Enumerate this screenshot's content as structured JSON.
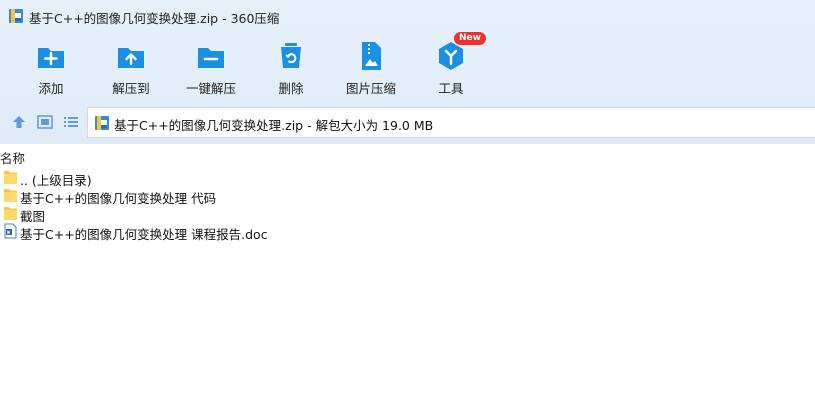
{
  "window": {
    "title": "基于C++的图像几何变换处理.zip - 360压缩"
  },
  "toolbar": {
    "items": [
      {
        "label": "添加",
        "icon": "add-icon"
      },
      {
        "label": "解压到",
        "icon": "extract-to-icon"
      },
      {
        "label": "一键解压",
        "icon": "one-click-extract-icon"
      },
      {
        "label": "删除",
        "icon": "delete-icon"
      },
      {
        "label": "图片压缩",
        "icon": "image-compress-icon"
      },
      {
        "label": "工具",
        "icon": "tools-icon"
      }
    ],
    "tools_badge": "New"
  },
  "nav": {
    "path": "基于C++的图像几何变换处理.zip - 解包大小为 19.0 MB"
  },
  "list": {
    "column_name": "名称",
    "rows": [
      {
        "name": ".. (上级目录)",
        "icon": "folder-icon"
      },
      {
        "name": "基于C++的图像几何变换处理 代码",
        "icon": "folder-icon"
      },
      {
        "name": "截图",
        "icon": "folder-icon"
      },
      {
        "name": "基于C++的图像几何变换处理 课程报告.doc",
        "icon": "word-doc-icon"
      }
    ]
  },
  "colors": {
    "accent": "#1a8fe3",
    "toolbar_bg": "#e4eef9",
    "badge": "#f0302f",
    "folder": "#f5c84b"
  }
}
